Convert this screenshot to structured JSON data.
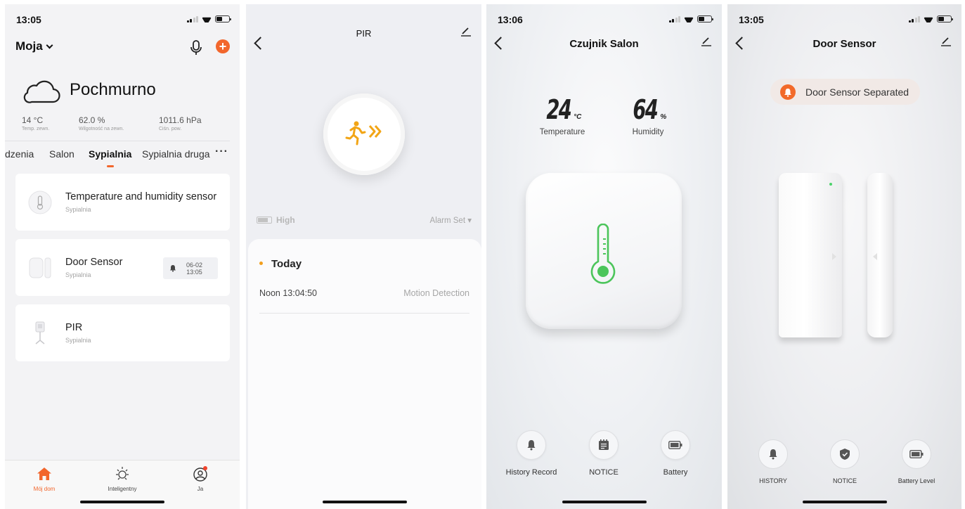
{
  "screens": {
    "home": {
      "status_time": "13:05",
      "home_name": "Moja",
      "weather": {
        "condition": "Pochmurno",
        "temp_value": "14 °C",
        "temp_label": "Temp. zewn.",
        "humidity_value": "62.0 %",
        "humidity_label": "Wilgotność na zewn.",
        "pressure_value": "1011.6 hPa",
        "pressure_label": "Ciśn. pow."
      },
      "rooms": [
        "dzenia",
        "Salon",
        "Sypialnia",
        "Sypialnia druga"
      ],
      "active_room": "Sypialnia",
      "more": "···",
      "devices": [
        {
          "name": "Temperature and humidity sensor",
          "room": "Sypialnia",
          "icon": "thermometer-device-icon"
        },
        {
          "name": "Door Sensor",
          "room": "Sypialnia",
          "icon": "door-sensor-device-icon",
          "alert_date": "06-02",
          "alert_time": "13:05"
        },
        {
          "name": "PIR",
          "room": "Sypialnia",
          "icon": "pir-device-icon"
        }
      ],
      "tabs": [
        {
          "label": "Mój dom",
          "icon": "house-icon",
          "active": true
        },
        {
          "label": "Inteligentny",
          "icon": "sun-icon",
          "active": false
        },
        {
          "label": "Ja",
          "icon": "profile-icon",
          "active": false
        }
      ]
    },
    "pir": {
      "title": "PIR",
      "battery_level": "High",
      "alarm_set": "Alarm Set ▾",
      "log_day": "Today",
      "log_entries": [
        {
          "time": "Noon  13:04:50",
          "event": "Motion Detection"
        }
      ]
    },
    "climate": {
      "status_time": "13:06",
      "title": "Czujnik Salon",
      "temperature": {
        "value": "24",
        "unit": "°C",
        "label": "Temperature"
      },
      "humidity": {
        "value": "64",
        "unit": "%",
        "label": "Humidity"
      },
      "actions": [
        {
          "label": "History Record",
          "icon": "bell-icon"
        },
        {
          "label": "NOTICE",
          "icon": "notice-icon"
        },
        {
          "label": "Battery",
          "icon": "battery-icon"
        }
      ]
    },
    "door": {
      "status_time": "13:05",
      "title": "Door Sensor",
      "status": "Door Sensor Separated",
      "actions": [
        {
          "label": "HISTORY",
          "icon": "bell-icon"
        },
        {
          "label": "NOTICE",
          "icon": "shield-icon"
        },
        {
          "label": "Battery Level",
          "icon": "battery-icon"
        }
      ]
    }
  },
  "colors": {
    "accent": "#f2662c",
    "pir_icon": "#f2a516",
    "thermo_green": "#4cc55b"
  }
}
